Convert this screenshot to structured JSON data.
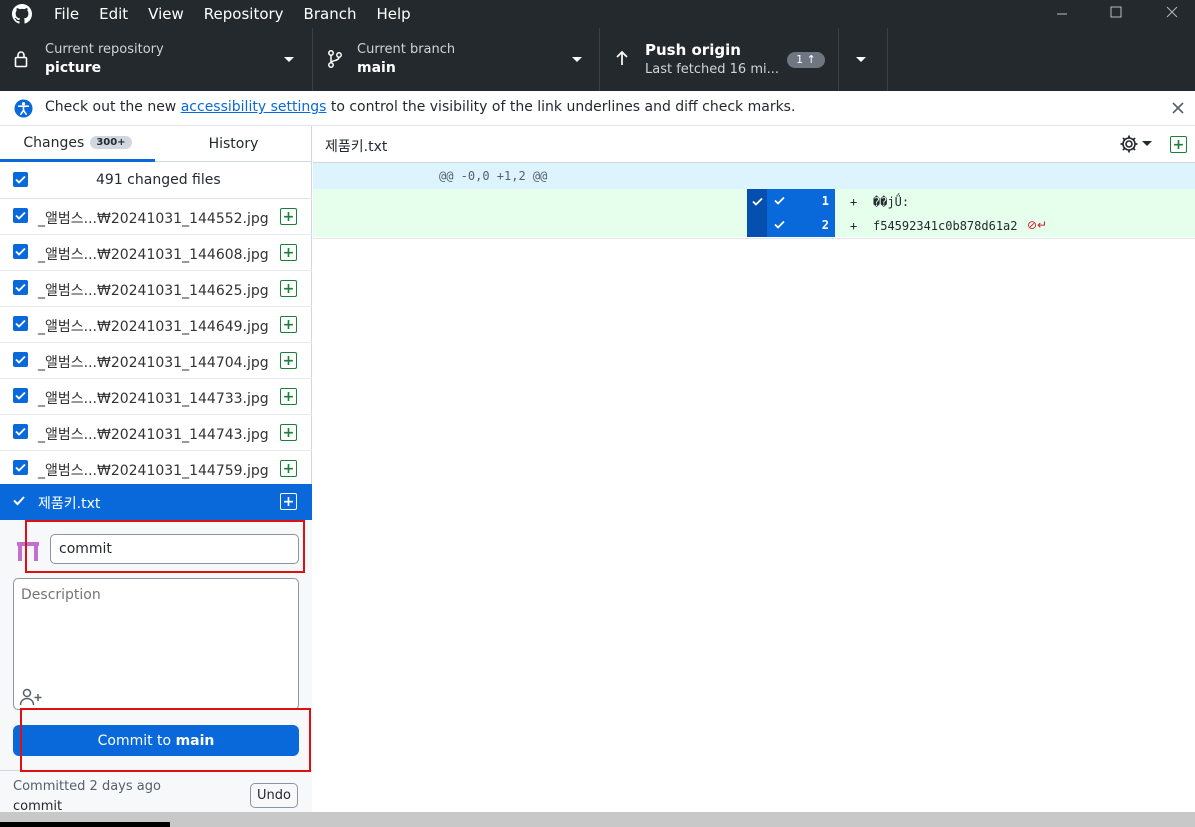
{
  "menu": [
    "File",
    "Edit",
    "View",
    "Repository",
    "Branch",
    "Help"
  ],
  "toolbar": {
    "repo_label": "Current repository",
    "repo_name": "picture",
    "branch_label": "Current branch",
    "branch_name": "main",
    "push_title": "Push origin",
    "push_sub": "Last fetched 16 mi...",
    "push_badge": "1 ↑"
  },
  "banner": {
    "pre": "Check out the new ",
    "link": "accessibility settings",
    "post": " to control the visibility of the link underlines and diff check marks."
  },
  "tabs": {
    "changes": "Changes",
    "changes_badge": "300+",
    "history": "History"
  },
  "changed_files_label": "491 changed files",
  "files": [
    "_앨범스...₩20241031_144552.jpg",
    "_앨범스...₩20241031_144608.jpg",
    "_앨범스...₩20241031_144625.jpg",
    "_앨범스...₩20241031_144649.jpg",
    "_앨범스...₩20241031_144704.jpg",
    "_앨범스...₩20241031_144733.jpg",
    "_앨범스...₩20241031_144743.jpg",
    "_앨범스...₩20241031_144759.jpg"
  ],
  "selected_file": "제품키.txt",
  "commit": {
    "summary_value": "commit",
    "description_placeholder": "Description",
    "button_prefix": "Commit to ",
    "button_branch": "main",
    "last_commit_time": "Committed 2 days ago",
    "last_commit_msg": "commit",
    "undo_label": "Undo"
  },
  "diff": {
    "file_name": "제품키.txt",
    "hunk_header": "@@ -0,0 +1,2 @@",
    "lines": [
      {
        "num": "1",
        "sign": "+",
        "text": "��jǗ:"
      },
      {
        "num": "2",
        "sign": "+",
        "text": "f54592341c0b878d61a2"
      }
    ]
  },
  "colors": {
    "accent": "#0969da",
    "added_bg": "#e6ffec",
    "dark": "#24292e",
    "annotation": "#e01010"
  }
}
